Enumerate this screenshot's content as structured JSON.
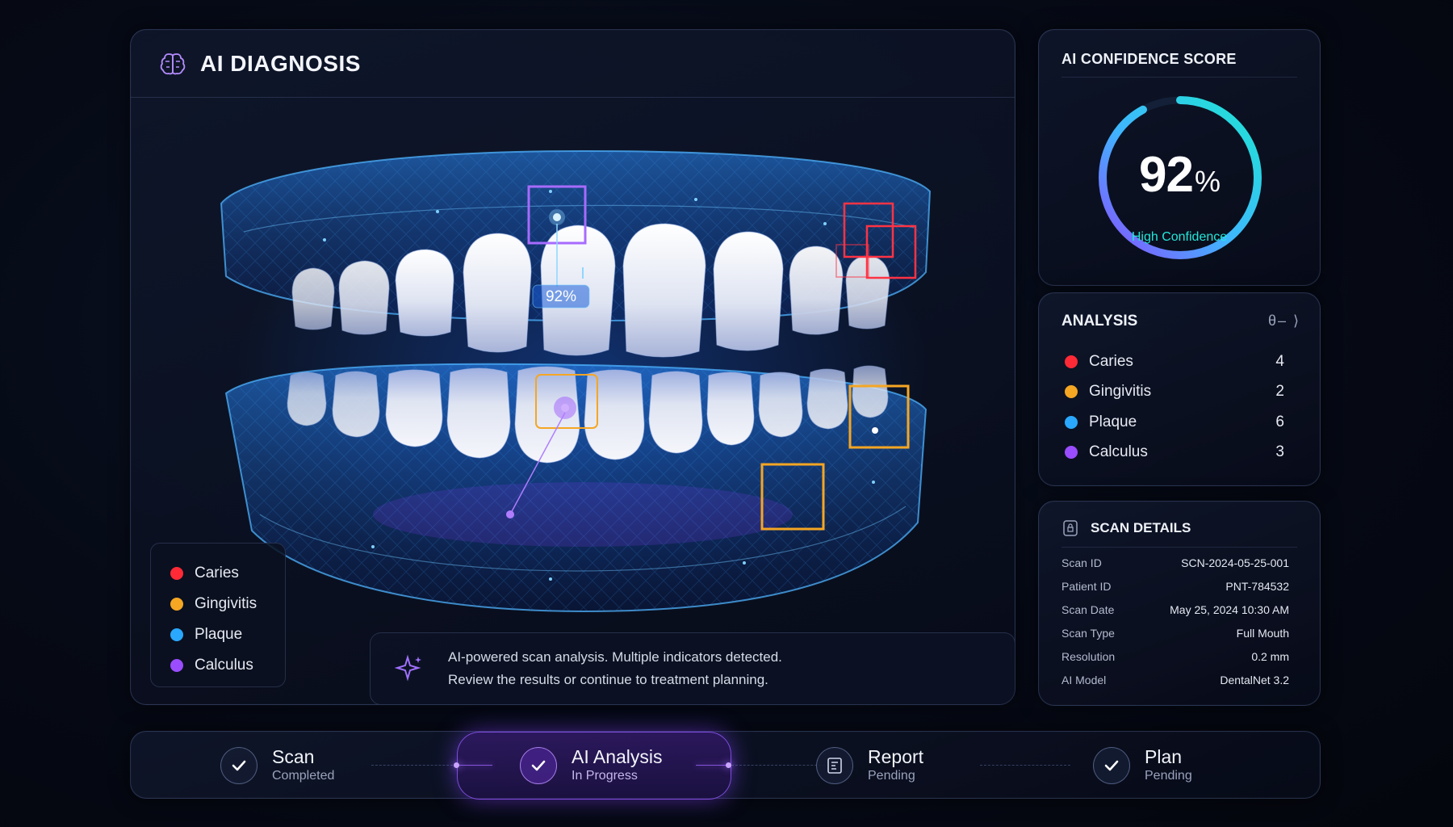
{
  "diagnosis": {
    "title": "AI DIAGNOSIS",
    "scan_marker_label": "92%",
    "legend": [
      {
        "label": "Caries",
        "color": "#ff2a36"
      },
      {
        "label": "Gingivitis",
        "color": "#f5a623"
      },
      {
        "label": "Plaque",
        "color": "#2aa8ff"
      },
      {
        "label": "Calculus",
        "color": "#9a4dff"
      }
    ],
    "notice": {
      "line1": "AI-powered scan analysis. Multiple indicators detected.",
      "line2": "Review the results or continue to treatment planning."
    }
  },
  "confidence": {
    "title": "AI CONFIDENCE SCORE",
    "value": "92",
    "unit": "%",
    "fraction": 0.92,
    "label": "High Confidence",
    "colors": {
      "ring_start": "#8a4dff",
      "ring_end": "#1ee6d2"
    }
  },
  "analysis": {
    "title": "ANALYSIS",
    "items": [
      {
        "label": "Caries",
        "count": "4",
        "color": "#ff2a36"
      },
      {
        "label": "Gingivitis",
        "count": "2",
        "color": "#f5a623"
      },
      {
        "label": "Plaque",
        "count": "6",
        "color": "#2aa8ff"
      },
      {
        "label": "Calculus",
        "count": "3",
        "color": "#9a4dff"
      }
    ]
  },
  "scan_details": {
    "title": "SCAN DETAILS",
    "rows": [
      {
        "key": "Scan ID",
        "value": "SCN-2024-05-25-001"
      },
      {
        "key": "Patient ID",
        "value": "PNT-784532"
      },
      {
        "key": "Scan Date",
        "value": "May 25, 2024 10:30 AM"
      },
      {
        "key": "Scan Type",
        "value": "Full Mouth"
      },
      {
        "key": "Resolution",
        "value": "0.2 mm"
      },
      {
        "key": "AI Model",
        "value": "DentalNet 3.2"
      }
    ]
  },
  "steps": [
    {
      "label": "Scan",
      "status": "Completed",
      "icon": "check-icon"
    },
    {
      "label": "AI Analysis",
      "status": "In Progress",
      "icon": "check-icon"
    },
    {
      "label": "Report",
      "status": "Pending",
      "icon": "report-icon"
    },
    {
      "label": "Plan",
      "status": "Pending",
      "icon": "check-icon"
    }
  ]
}
